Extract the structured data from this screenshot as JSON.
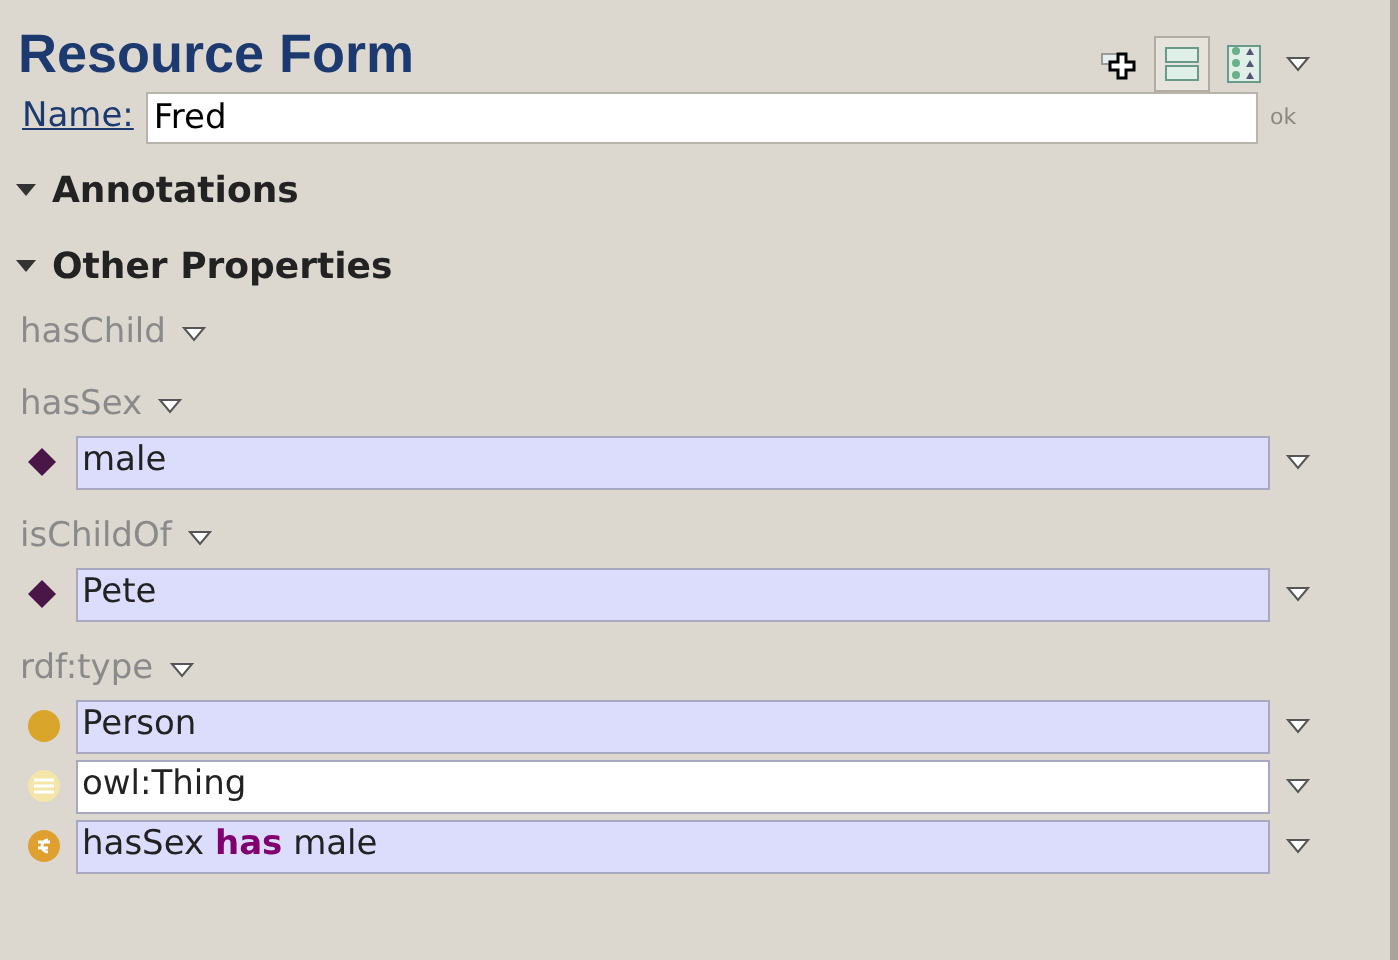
{
  "form": {
    "title": "Resource Form"
  },
  "toolbar": [
    {
      "kind": "add",
      "selected": false
    },
    {
      "kind": "rows",
      "selected": true
    },
    {
      "kind": "grid",
      "selected": false
    }
  ],
  "name_field": {
    "label": "Name:",
    "value": "Fred",
    "action": "ok"
  },
  "sections": [
    {
      "title": "Annotations",
      "expanded": true
    },
    {
      "title": "Other Properties",
      "expanded": true
    }
  ],
  "properties": [
    {
      "name": "hasChild"
    },
    {
      "name": "hasSex",
      "values": [
        {
          "kind": "individual",
          "text": "male",
          "highlighted": true
        }
      ]
    },
    {
      "name": "isChildOf",
      "values": [
        {
          "kind": "individual",
          "text": "Pete",
          "highlighted": true
        }
      ]
    },
    {
      "name": "rdf:type",
      "values": [
        {
          "kind": "class",
          "text": "Person",
          "highlighted": true
        },
        {
          "kind": "thing",
          "text": "owl:Thing",
          "highlighted": false
        },
        {
          "kind": "restriction",
          "text": "hasSex **has** male",
          "highlighted": true
        }
      ]
    }
  ]
}
